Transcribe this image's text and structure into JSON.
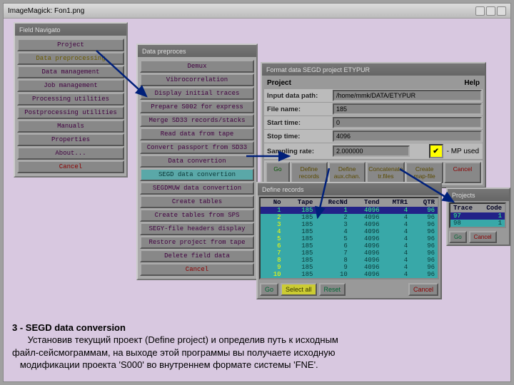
{
  "outer_title": "ImageMagick: Fon1.png",
  "field_nav": {
    "title": "Field Navigato",
    "items": [
      "Project",
      "Data preprocessing",
      "Data management",
      "Job management",
      "Processing utilities",
      "Postprocessing utilities",
      "Manuals",
      "Properties",
      "About...",
      "Cancel"
    ]
  },
  "preproc": {
    "title": "Data preproces",
    "items": [
      "Demux",
      "Vibrocorrelation",
      "Display initial traces",
      "Prepare S002 for express",
      "Merge SD33 records/stacks",
      "Read data from tape",
      "Convert passport from SD33",
      "Data convertion",
      "SEGD data convertion",
      "SEGDMUW data convertion",
      "Create tables",
      "Create tables from SPS",
      "SEGY-file headers display",
      "Restore project from tape",
      "Delete field data",
      "Cancel"
    ]
  },
  "form": {
    "title": "Format data SEGD project ETYPUR",
    "project_label": "Project",
    "help": "Help",
    "rows": {
      "input": "Input data path:",
      "file": "File name:",
      "start": "Start time:",
      "stop": "Stop time:",
      "sr": "Sampling rate:"
    },
    "vals": {
      "input": "/home/mmk/DATA/ETYPUR",
      "file": "185",
      "start": "0",
      "stop": "4096",
      "sr": "2.000000"
    },
    "mp": " - MP used",
    "btns": {
      "go": "Go",
      "def": "Define records",
      "aux": "Define aux.chan.",
      "cat": "Concatenate tr.files",
      "map": "Create map-file",
      "cancel": "Cancel"
    }
  },
  "records": {
    "title": "Define records",
    "cols": [
      "No",
      "Tape",
      "RecNd",
      "Tend",
      "MTR1",
      "QTR"
    ],
    "rows": [
      [
        "1",
        "185",
        "1",
        "4096",
        "4",
        "96"
      ],
      [
        "2",
        "185",
        "2",
        "4096",
        "4",
        "96"
      ],
      [
        "3",
        "185",
        "3",
        "4096",
        "4",
        "96"
      ],
      [
        "4",
        "185",
        "4",
        "4096",
        "4",
        "96"
      ],
      [
        "5",
        "185",
        "5",
        "4096",
        "4",
        "96"
      ],
      [
        "6",
        "185",
        "6",
        "4096",
        "4",
        "96"
      ],
      [
        "7",
        "185",
        "7",
        "4096",
        "4",
        "96"
      ],
      [
        "8",
        "185",
        "8",
        "4096",
        "4",
        "96"
      ],
      [
        "9",
        "185",
        "9",
        "4096",
        "4",
        "96"
      ],
      [
        "10",
        "185",
        "10",
        "4096",
        "4",
        "96"
      ]
    ],
    "btns": {
      "go": "Go",
      "sel": "Select all",
      "reset": "Reset",
      "cancel": "Cancel"
    }
  },
  "projects": {
    "title": "Projects",
    "cols": [
      "Trace",
      "Code"
    ],
    "rows": [
      [
        "97",
        "1"
      ],
      [
        "98",
        "1"
      ]
    ],
    "btns": {
      "go": "Go",
      "cancel": "Cancel"
    }
  },
  "caption": {
    "h": "3 - SEGD data conversion",
    "p1": "Установив текущий проект (Define project) и определив  путь  к  исходным",
    "p2": "файл-сейсмограммам, на выходе этой программы вы получаете  исходную",
    "p3": "модификации проекта 'S000'  во внутреннем формате системы 'FNE'."
  }
}
